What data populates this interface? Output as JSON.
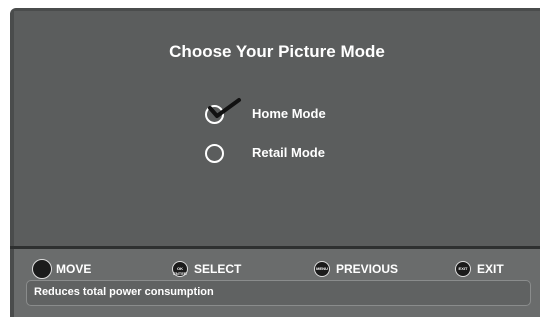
{
  "screen": {
    "title": "Choose Your Picture Mode"
  },
  "options": [
    {
      "label": "Home Mode",
      "selected": true
    },
    {
      "label": "Retail Mode",
      "selected": false
    }
  ],
  "nav": {
    "move": {
      "label": "MOVE",
      "icon": "dpad-icon"
    },
    "select": {
      "label": "SELECT",
      "icon": "ok-enter-icon",
      "button_text": "OK ENTER"
    },
    "previous": {
      "label": "PREVIOUS",
      "icon": "menu-button-icon",
      "button_text": "MENU"
    },
    "exit": {
      "label": "EXIT",
      "icon": "exit-button-icon",
      "button_text": "EXIT"
    }
  },
  "description": "Reduces total power consumption",
  "colors": {
    "frame": "#4a4c4c",
    "panel": "#5b5d5d",
    "text": "#ffffff"
  }
}
